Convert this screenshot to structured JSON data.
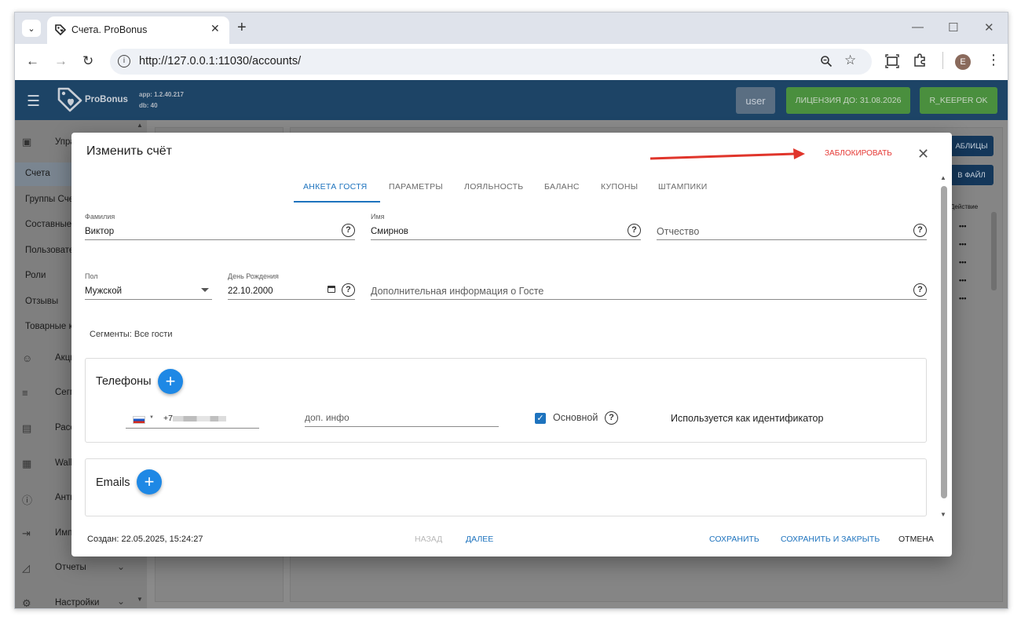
{
  "browser": {
    "tab_title": "Счета. ProBonus",
    "tab_close": "✕",
    "new_tab": "+",
    "url": "http://127.0.0.1:11030/accounts/",
    "profile_initial": "E"
  },
  "appbar": {
    "brand": "ProBonus",
    "app_version": "app: 1.2.40.217",
    "db_version": "db: 40",
    "user_label": "user",
    "license_label": "ЛИЦЕНЗИЯ ДО: 31.08.2026",
    "rkeeper_label": "R_KEEPER OK",
    "colors": {
      "appbar": "#1d4466",
      "green": "#4a8f3e",
      "user_btn": "#5a6e82"
    }
  },
  "sidebar": {
    "section_label": "Упра",
    "items": [
      "Счета",
      "Группы Счет",
      "Составные",
      "Пользовате",
      "Роли",
      "Отзывы",
      "Товарные к"
    ],
    "groups": [
      {
        "label": "Акци",
        "icon": "smiley-icon"
      },
      {
        "label": "Сегм",
        "icon": "list-icon"
      },
      {
        "label": "Расс",
        "icon": "mail-icon"
      },
      {
        "label": "Wall",
        "icon": "wallet-icon"
      },
      {
        "label": "Анти",
        "icon": "alert-icon"
      },
      {
        "label": "Имп",
        "icon": "import-icon"
      },
      {
        "label": "Отчеты",
        "icon": "chart-icon"
      },
      {
        "label": "Настройки",
        "icon": "gear-icon"
      }
    ]
  },
  "background": {
    "btn_tables": "АБЛИЦЫ",
    "btn_file": "В ФАЙЛ",
    "col_action": "Действие",
    "dots": "•••"
  },
  "dialog": {
    "title": "Изменить счёт",
    "block_label": "ЗАБЛОКИРОВАТЬ",
    "close": "✕",
    "tabs": [
      "АНКЕТА ГОСТЯ",
      "ПАРАМЕТРЫ",
      "ЛОЯЛЬНОСТЬ",
      "БАЛАНС",
      "КУПОНЫ",
      "ШТАМПИКИ"
    ],
    "fields": {
      "last_name": {
        "label": "Фамилия",
        "value": "Виктор"
      },
      "first_name": {
        "label": "Имя",
        "value": "Смирнов"
      },
      "middle_name": {
        "placeholder": "Отчество"
      },
      "gender": {
        "label": "Пол",
        "value": "Мужской"
      },
      "birthday": {
        "label": "День Рождения",
        "value": "22.10.2000"
      },
      "extra_info": {
        "placeholder": "Дополнительная информация о Госте"
      }
    },
    "segments": "Сегменты: Все гости",
    "phones": {
      "title": "Телефоны",
      "prefix": "+7",
      "extra_placeholder": "доп. инфо",
      "main_label": "Основной",
      "identifier_label": "Используется как идентификатор"
    },
    "emails": {
      "title": "Emails"
    },
    "footer": {
      "created": "Создан: 22.05.2025, 15:24:27",
      "back": "НАЗАД",
      "next": "ДАЛЕЕ",
      "save": "СОХРАНИТЬ",
      "save_close": "СОХРАНИТЬ И ЗАКРЫТЬ",
      "cancel": "ОТМЕНА"
    },
    "colors": {
      "accent": "#1e73be",
      "danger": "#e53935"
    }
  }
}
